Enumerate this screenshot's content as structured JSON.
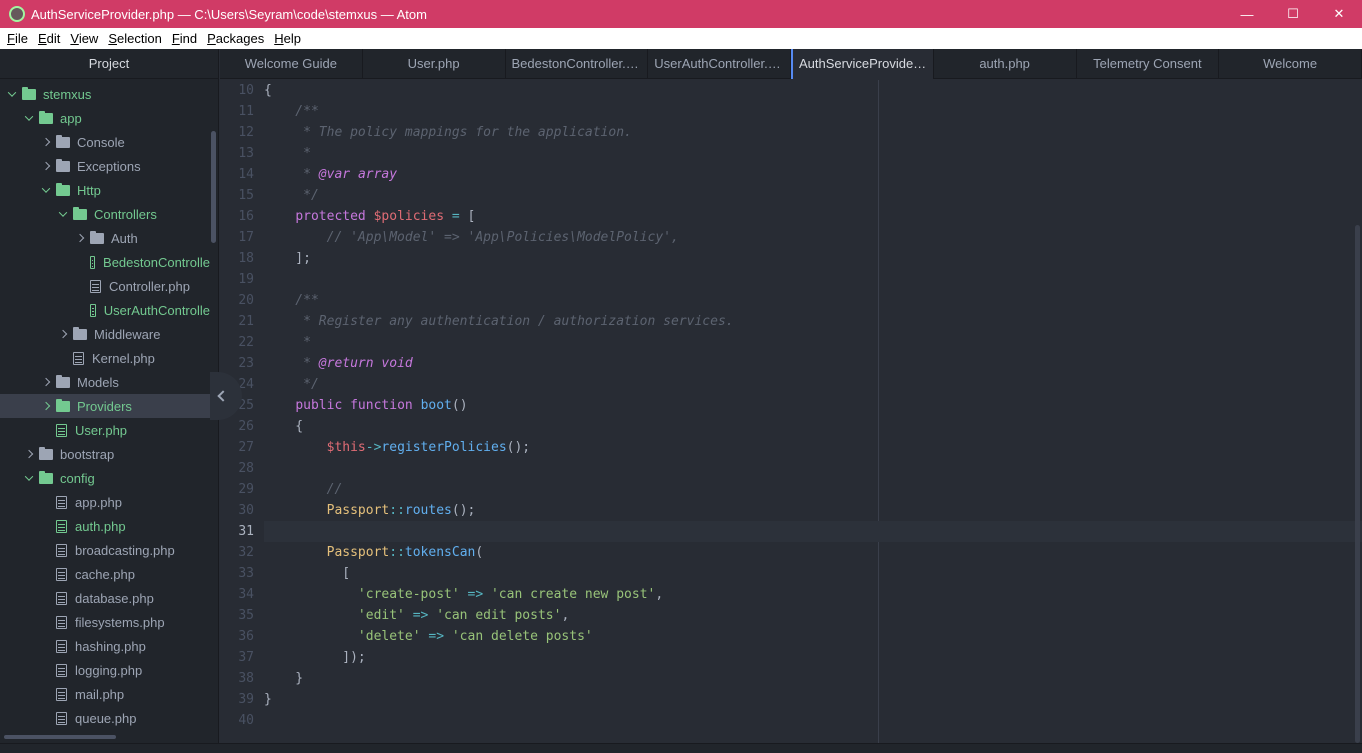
{
  "window": {
    "title": "AuthServiceProvider.php — C:\\Users\\Seyram\\code\\stemxus — Atom",
    "minimize_glyph": "—",
    "maximize_glyph": "☐",
    "close_glyph": "✕"
  },
  "menu": [
    "File",
    "Edit",
    "View",
    "Selection",
    "Find",
    "Packages",
    "Help"
  ],
  "tree": {
    "header": "Project",
    "items": [
      {
        "label": "stemxus",
        "depth": 0,
        "type": "folder",
        "chevron": "down",
        "green": true
      },
      {
        "label": "app",
        "depth": 1,
        "type": "folder",
        "chevron": "down",
        "green": true
      },
      {
        "label": "Console",
        "depth": 2,
        "type": "folder",
        "chevron": "right",
        "green": false
      },
      {
        "label": "Exceptions",
        "depth": 2,
        "type": "folder",
        "chevron": "right",
        "green": false
      },
      {
        "label": "Http",
        "depth": 2,
        "type": "folder",
        "chevron": "down",
        "green": true
      },
      {
        "label": "Controllers",
        "depth": 3,
        "type": "folder",
        "chevron": "down",
        "green": true
      },
      {
        "label": "Auth",
        "depth": 4,
        "type": "folder",
        "chevron": "right",
        "green": false
      },
      {
        "label": "BedestonControlle",
        "depth": 4,
        "type": "file",
        "green": true
      },
      {
        "label": "Controller.php",
        "depth": 4,
        "type": "file",
        "green": false
      },
      {
        "label": "UserAuthControlle",
        "depth": 4,
        "type": "file",
        "green": true
      },
      {
        "label": "Middleware",
        "depth": 3,
        "type": "folder",
        "chevron": "right",
        "green": false
      },
      {
        "label": "Kernel.php",
        "depth": 3,
        "type": "file",
        "green": false
      },
      {
        "label": "Models",
        "depth": 2,
        "type": "folder",
        "chevron": "right",
        "green": false
      },
      {
        "label": "Providers",
        "depth": 2,
        "type": "folder",
        "chevron": "right",
        "green": true,
        "selected": true
      },
      {
        "label": "User.php",
        "depth": 2,
        "type": "file",
        "green": true
      },
      {
        "label": "bootstrap",
        "depth": 1,
        "type": "folder",
        "chevron": "right",
        "green": false
      },
      {
        "label": "config",
        "depth": 1,
        "type": "folder",
        "chevron": "down",
        "green": true
      },
      {
        "label": "app.php",
        "depth": 2,
        "type": "file",
        "green": false
      },
      {
        "label": "auth.php",
        "depth": 2,
        "type": "file",
        "green": true
      },
      {
        "label": "broadcasting.php",
        "depth": 2,
        "type": "file",
        "green": false
      },
      {
        "label": "cache.php",
        "depth": 2,
        "type": "file",
        "green": false
      },
      {
        "label": "database.php",
        "depth": 2,
        "type": "file",
        "green": false
      },
      {
        "label": "filesystems.php",
        "depth": 2,
        "type": "file",
        "green": false
      },
      {
        "label": "hashing.php",
        "depth": 2,
        "type": "file",
        "green": false
      },
      {
        "label": "logging.php",
        "depth": 2,
        "type": "file",
        "green": false
      },
      {
        "label": "mail.php",
        "depth": 2,
        "type": "file",
        "green": false
      },
      {
        "label": "queue.php",
        "depth": 2,
        "type": "file",
        "green": false
      }
    ]
  },
  "tabs": [
    {
      "label": "Welcome Guide",
      "active": false
    },
    {
      "label": "User.php",
      "active": false
    },
    {
      "label": "BedestonController.php",
      "active": false
    },
    {
      "label": "UserAuthController.php",
      "active": false
    },
    {
      "label": "AuthServiceProvider.p...",
      "active": true
    },
    {
      "label": "auth.php",
      "active": false
    },
    {
      "label": "Telemetry Consent",
      "active": false
    },
    {
      "label": "Welcome",
      "active": false
    }
  ],
  "editor": {
    "current_line": 31,
    "lines": [
      {
        "n": "10",
        "tokens": [
          [
            "punc",
            "{"
          ]
        ]
      },
      {
        "n": "11",
        "tokens": [
          [
            "com",
            "    /**"
          ]
        ]
      },
      {
        "n": "12",
        "tokens": [
          [
            "com",
            "     * The policy mappings for the application."
          ]
        ]
      },
      {
        "n": "13",
        "tokens": [
          [
            "com",
            "     *"
          ]
        ]
      },
      {
        "n": "14",
        "tokens": [
          [
            "com",
            "     * "
          ],
          [
            "tag",
            "@var"
          ],
          [
            "com",
            " "
          ],
          [
            "tag",
            "array"
          ]
        ]
      },
      {
        "n": "15",
        "tokens": [
          [
            "com",
            "     */"
          ]
        ]
      },
      {
        "n": "16",
        "tokens": [
          [
            "punc",
            "    "
          ],
          [
            "kw",
            "protected"
          ],
          [
            "punc",
            " "
          ],
          [
            "var",
            "$policies"
          ],
          [
            "punc",
            " "
          ],
          [
            "op",
            "="
          ],
          [
            "punc",
            " ["
          ]
        ]
      },
      {
        "n": "17",
        "tokens": [
          [
            "com",
            "        // 'App\\Model' => 'App\\Policies\\ModelPolicy',"
          ]
        ]
      },
      {
        "n": "18",
        "tokens": [
          [
            "punc",
            "    ];"
          ]
        ]
      },
      {
        "n": "19",
        "tokens": []
      },
      {
        "n": "20",
        "tokens": [
          [
            "com",
            "    /**"
          ]
        ]
      },
      {
        "n": "21",
        "tokens": [
          [
            "com",
            "     * Register any authentication / authorization services."
          ]
        ]
      },
      {
        "n": "22",
        "tokens": [
          [
            "com",
            "     *"
          ]
        ]
      },
      {
        "n": "23",
        "tokens": [
          [
            "com",
            "     * "
          ],
          [
            "tag",
            "@return"
          ],
          [
            "com",
            " "
          ],
          [
            "tag",
            "void"
          ]
        ]
      },
      {
        "n": "24",
        "tokens": [
          [
            "com",
            "     */"
          ]
        ]
      },
      {
        "n": "25",
        "tokens": [
          [
            "punc",
            "    "
          ],
          [
            "kw",
            "public"
          ],
          [
            "punc",
            " "
          ],
          [
            "kw",
            "function"
          ],
          [
            "punc",
            " "
          ],
          [
            "fn",
            "boot"
          ],
          [
            "punc",
            "()"
          ]
        ]
      },
      {
        "n": "26",
        "tokens": [
          [
            "punc",
            "    {"
          ]
        ]
      },
      {
        "n": "27",
        "tokens": [
          [
            "punc",
            "        "
          ],
          [
            "var",
            "$this"
          ],
          [
            "op",
            "->"
          ],
          [
            "fn",
            "registerPolicies"
          ],
          [
            "punc",
            "();"
          ]
        ]
      },
      {
        "n": "28",
        "tokens": []
      },
      {
        "n": "29",
        "tokens": [
          [
            "com",
            "        //"
          ]
        ]
      },
      {
        "n": "30",
        "tokens": [
          [
            "punc",
            "        "
          ],
          [
            "cls",
            "Passport"
          ],
          [
            "op",
            "::"
          ],
          [
            "fn",
            "routes"
          ],
          [
            "punc",
            "();"
          ]
        ]
      },
      {
        "n": "31",
        "tokens": []
      },
      {
        "n": "32",
        "tokens": [
          [
            "punc",
            "        "
          ],
          [
            "cls",
            "Passport"
          ],
          [
            "op",
            "::"
          ],
          [
            "fn",
            "tokensCan"
          ],
          [
            "punc",
            "("
          ]
        ]
      },
      {
        "n": "33",
        "tokens": [
          [
            "punc",
            "          ["
          ]
        ]
      },
      {
        "n": "34",
        "tokens": [
          [
            "punc",
            "            "
          ],
          [
            "str",
            "'create-post'"
          ],
          [
            "punc",
            " "
          ],
          [
            "op",
            "=>"
          ],
          [
            "punc",
            " "
          ],
          [
            "str",
            "'can create new post'"
          ],
          [
            "punc",
            ","
          ]
        ]
      },
      {
        "n": "35",
        "tokens": [
          [
            "punc",
            "            "
          ],
          [
            "str",
            "'edit'"
          ],
          [
            "punc",
            " "
          ],
          [
            "op",
            "=>"
          ],
          [
            "punc",
            " "
          ],
          [
            "str",
            "'can edit posts'"
          ],
          [
            "punc",
            ","
          ]
        ]
      },
      {
        "n": "36",
        "tokens": [
          [
            "punc",
            "            "
          ],
          [
            "str",
            "'delete'"
          ],
          [
            "punc",
            " "
          ],
          [
            "op",
            "=>"
          ],
          [
            "punc",
            " "
          ],
          [
            "str",
            "'can delete posts'"
          ]
        ]
      },
      {
        "n": "37",
        "tokens": [
          [
            "punc",
            "          ]);"
          ]
        ]
      },
      {
        "n": "38",
        "tokens": [
          [
            "punc",
            "    }"
          ]
        ]
      },
      {
        "n": "39",
        "tokens": [
          [
            "punc",
            "}"
          ]
        ]
      },
      {
        "n": "40",
        "tokens": []
      }
    ]
  },
  "colors": {
    "titlebar": "#d03b66",
    "accent": "#568af2",
    "git_added": "#73c990"
  }
}
